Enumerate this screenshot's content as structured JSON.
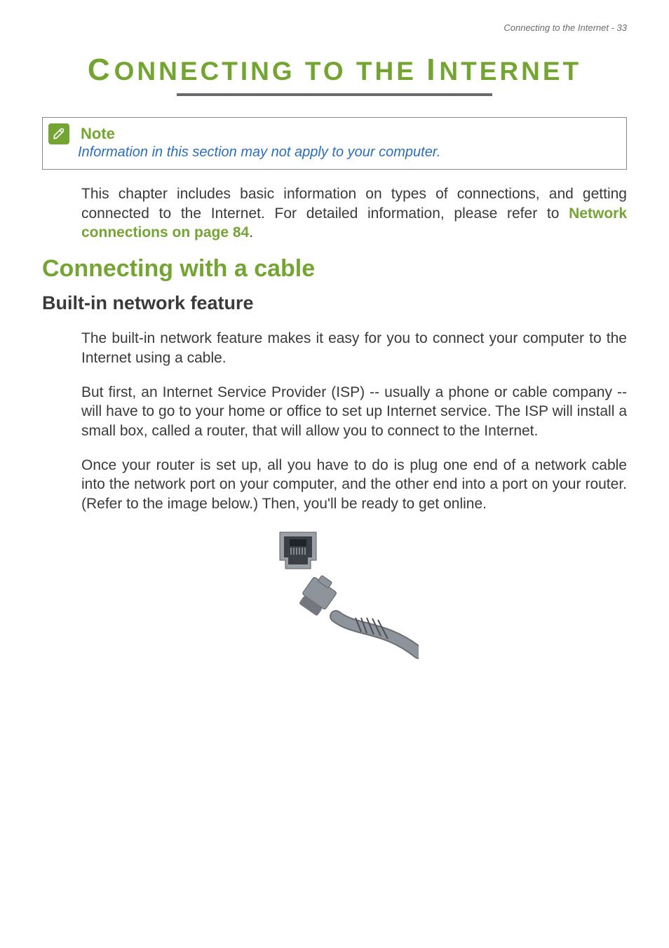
{
  "runningHead": "Connecting to the Internet - 33",
  "chapterTitle": {
    "c1": "C",
    "w1": "ONNECTING",
    "sp1": " ",
    "w2": "TO",
    "sp2": " ",
    "w3": "THE",
    "sp3": " ",
    "c2": "I",
    "w4": "NTERNET"
  },
  "note": {
    "heading": "Note",
    "body": "Information in this section may not apply to your computer."
  },
  "intro": {
    "part1": "This chapter includes basic information on types of connections, and getting connected to the Internet. For detailed information, please refer to ",
    "link": "Network connections on page 84",
    "part2": "."
  },
  "section": "Connecting with a cable",
  "subsection": "Built-in network feature",
  "para1": "The built-in network feature makes it easy for you to connect your computer to the Internet using a cable.",
  "para2": "But first, an Internet Service Provider (ISP) -- usually a phone or cable company -- will have to go to your home or office to set up Internet service. The ISP will install a small box, called a router, that will allow you to connect to the Internet.",
  "para3": "Once your router is set up, all you have to do is plug one end of a network cable into the network port on your computer, and the other end into a port on your router. (Refer to the image below.) Then, you'll be ready to get online."
}
